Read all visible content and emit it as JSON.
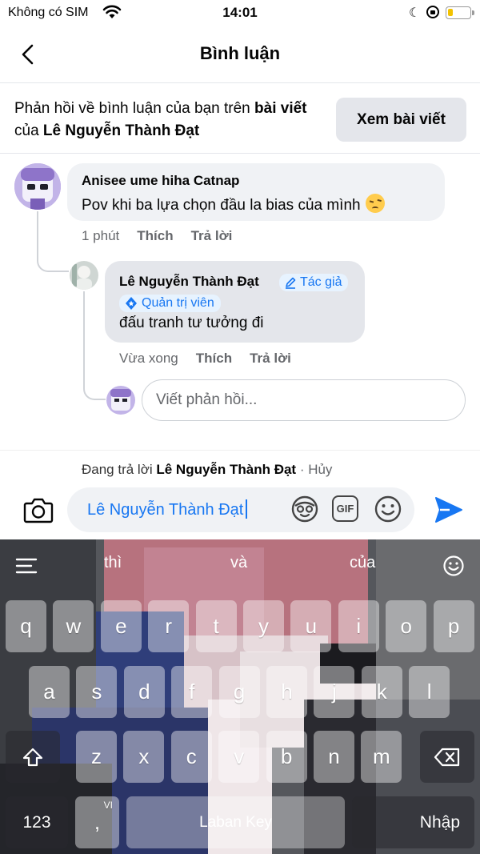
{
  "status_bar": {
    "carrier": "Không có SIM",
    "time": "14:01",
    "battery_level": 0.25
  },
  "header": {
    "title": "Bình luận"
  },
  "banner": {
    "prefix": "Phản hồi về bình luận của bạn trên ",
    "post_word": "bài viết",
    "of_word": " của ",
    "post_owner": "Lê Nguyễn Thành Đạt",
    "view_button": "Xem bài viết"
  },
  "comments": [
    {
      "author": "Anisee ume hiha Catnap",
      "text": "Pov khi ba lựa chọn đầu la bias của mình",
      "emoji": "pensive-face",
      "time": "1 phút",
      "like": "Thích",
      "reply": "Trả lời"
    },
    {
      "author": "Lê Nguyễn Thành Đạt",
      "author_badge": "Tác giả",
      "role_badge": "Quản trị viên",
      "text": "đấu tranh tư tưởng đi",
      "time": "Vừa xong",
      "like": "Thích",
      "reply": "Trả lời"
    }
  ],
  "reply_field": {
    "placeholder": "Viết phản hồi..."
  },
  "composer": {
    "replying_prefix": "Đang trả lời ",
    "replying_to": "Lê Nguyễn Thành Đạt",
    "separator": " · ",
    "cancel": "Hủy",
    "value": "Lê Nguyễn Thành Đạt",
    "gif_label": "GIF"
  },
  "keyboard": {
    "suggestions": [
      "thì",
      "và",
      "của"
    ],
    "row1": [
      "q",
      "w",
      "e",
      "r",
      "t",
      "y",
      "u",
      "i",
      "o",
      "p"
    ],
    "row2": [
      "a",
      "s",
      "d",
      "f",
      "g",
      "h",
      "j",
      "k",
      "l"
    ],
    "row3": [
      "z",
      "x",
      "c",
      "v",
      "b",
      "n",
      "m"
    ],
    "numbers_key": "123",
    "comma_key": ",",
    "lang_hint": "VI",
    "space_label": "Laban Key",
    "enter_label": "Nhập"
  },
  "colors": {
    "accent": "#1877f2",
    "bubble": "#f0f2f5",
    "bubble_author": "#e4e6eb",
    "muted_text": "#65676b"
  }
}
